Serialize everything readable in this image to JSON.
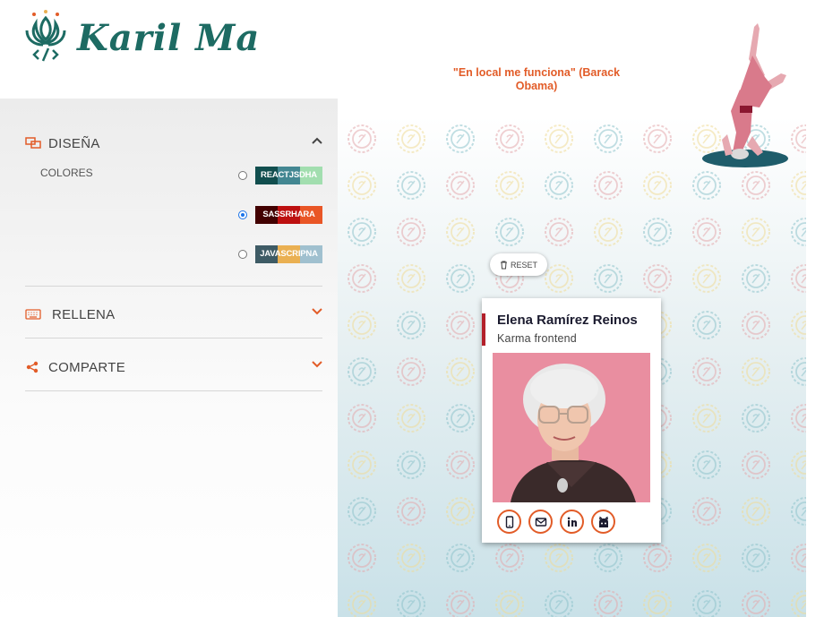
{
  "brand": {
    "name": "Karil Ma",
    "quote": "\"En local me funciona\" (Barack Obama)",
    "color": "#1d6b63"
  },
  "sidebar": {
    "design": {
      "title": "DISEÑA",
      "colors_label": "COLORES",
      "palettes": [
        {
          "label": "REACTJSDHA",
          "colors": [
            "#114e4e",
            "#438792",
            "#a2deaf"
          ],
          "checked": false
        },
        {
          "label": "SASSRHARA",
          "colors": [
            "#420101",
            "#bd1010",
            "#e95626"
          ],
          "checked": true
        },
        {
          "label": "JAVASCRIPNA",
          "colors": [
            "#3e5b65",
            "#eab052",
            "#a0c0cf"
          ],
          "checked": false
        }
      ]
    },
    "fill": {
      "title": "RELLENA"
    },
    "share": {
      "title": "COMPARTE"
    }
  },
  "preview": {
    "reset_label": "RESET",
    "card": {
      "name": "Elena Ramírez Reinos",
      "job": "Karma frontend",
      "links": [
        "phone-icon",
        "mail-icon",
        "linkedin-icon",
        "github-icon"
      ]
    }
  },
  "colors": {
    "accent": "#e25c28",
    "card_bar": "#b3202a"
  }
}
